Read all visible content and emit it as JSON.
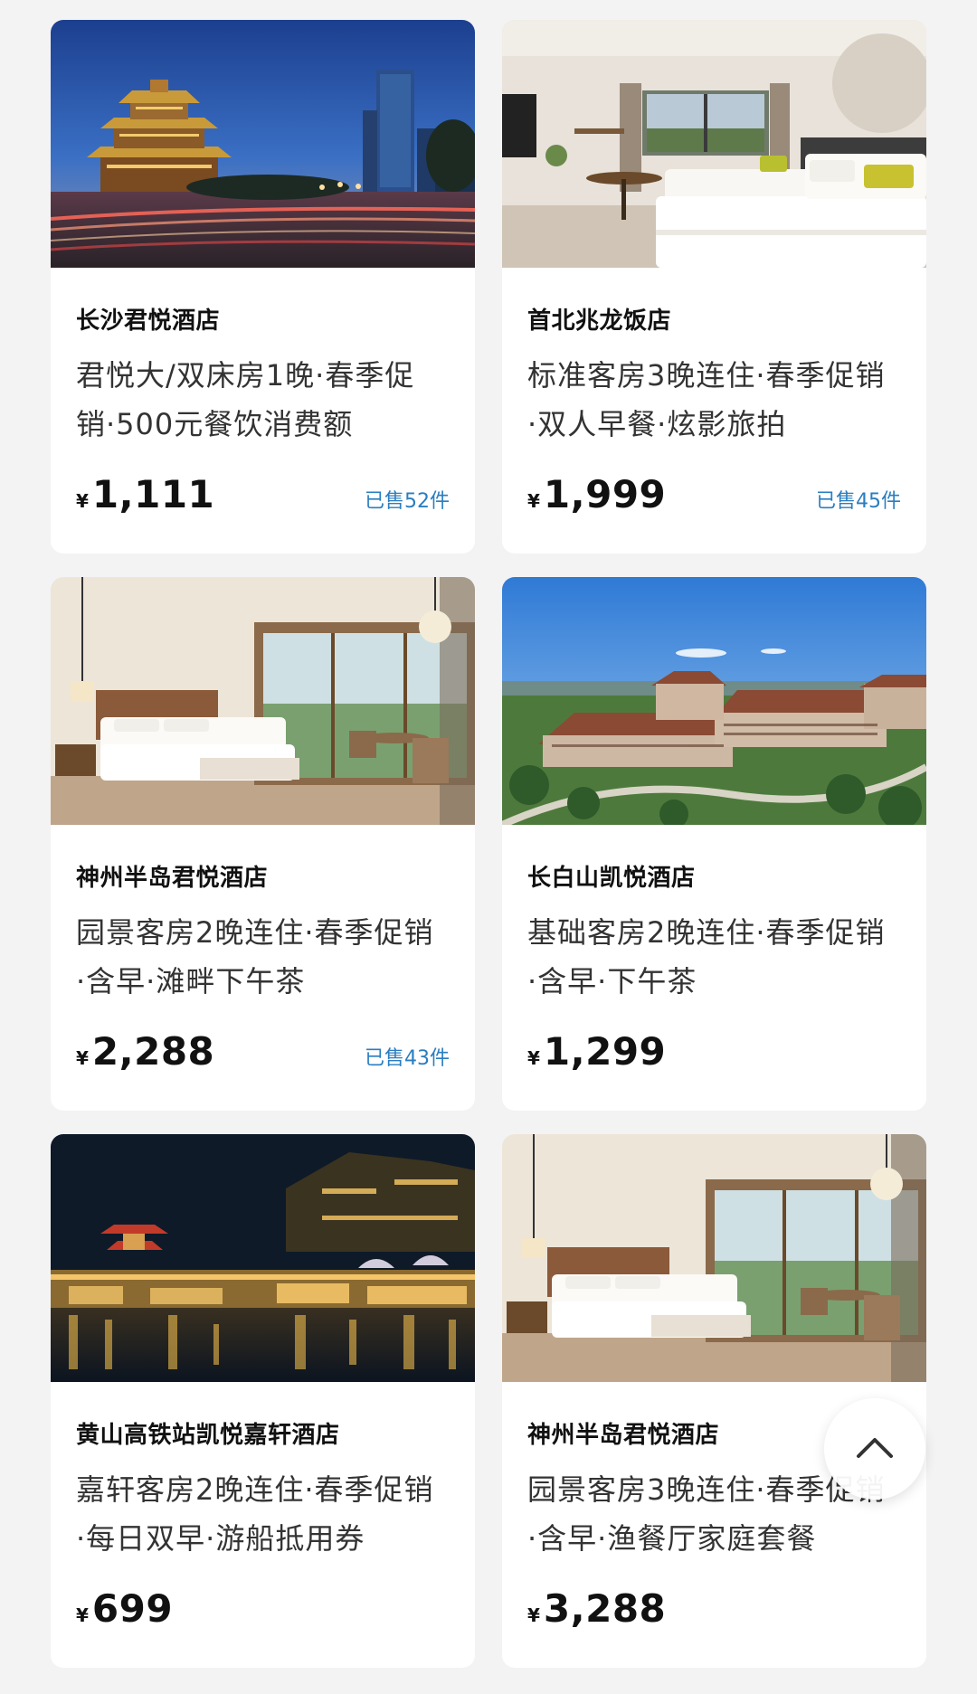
{
  "currency_symbol": "¥",
  "products": [
    {
      "hotel_name": "长沙君悦酒店",
      "description": "君悦大/双床房1晚·春季促销·500元餐饮消费额",
      "price": "1,111",
      "sold": "已售52件",
      "image": "night-city-pagoda-skyline"
    },
    {
      "hotel_name": "首北兆龙饭店",
      "description": "标准客房3晚连住·春季促销·双人早餐·炫影旅拍",
      "price": "1,999",
      "sold": "已售45件",
      "image": "twin-bed-room"
    },
    {
      "hotel_name": "神州半岛君悦酒店",
      "description": "园景客房2晚连住·春季促销·含早·滩畔下午茶",
      "price": "2,288",
      "sold": "已售43件",
      "image": "resort-bedroom-balcony"
    },
    {
      "hotel_name": "长白山凯悦酒店",
      "description": "基础客房2晚连住·春季促销·含早·下午茶",
      "price": "1,299",
      "sold": "",
      "image": "mountain-resort-exterior"
    },
    {
      "hotel_name": "黄山高铁站凯悦嘉轩酒店",
      "description": "嘉轩客房2晚连住·春季促销·每日双早·游船抵用券",
      "price": "699",
      "sold": "",
      "image": "night-riverside-lights"
    },
    {
      "hotel_name": "神州半岛君悦酒店",
      "description": "园景客房3晚连住·春季促销·含早·渔餐厅家庭套餐",
      "price": "3,288",
      "sold": "",
      "image": "resort-bedroom-balcony"
    }
  ],
  "back_to_top_icon": "chevron-up-icon"
}
